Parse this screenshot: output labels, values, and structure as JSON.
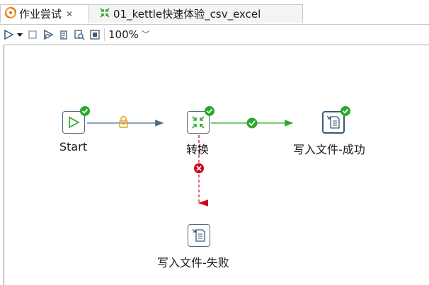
{
  "tabs": [
    {
      "label": "作业尝试",
      "icon": "job-icon",
      "active": true
    },
    {
      "label": "01_kettle快速体验_csv_excel",
      "icon": "transformation-icon",
      "active": false
    }
  ],
  "toolbar": {
    "zoom": "100%",
    "buttons": [
      "run",
      "run-options",
      "stop",
      "preview",
      "debug",
      "check",
      "impact",
      "sql"
    ]
  },
  "canvas": {
    "nodes": [
      {
        "id": "start",
        "label": "Start",
        "icon": "start-icon",
        "status": "success"
      },
      {
        "id": "transform",
        "label": "转换",
        "icon": "transformation-icon",
        "status": "success"
      },
      {
        "id": "write_success",
        "label": "写入文件-成功",
        "icon": "write-file-icon",
        "status": "success"
      },
      {
        "id": "write_fail",
        "label": "写入文件-失败",
        "icon": "write-file-icon",
        "status": "none"
      }
    ],
    "hops": [
      {
        "from": "start",
        "to": "transform",
        "type": "unconditional",
        "icon": "lock-icon"
      },
      {
        "from": "transform",
        "to": "write_success",
        "type": "success",
        "icon": "check-icon"
      },
      {
        "from": "transform",
        "to": "write_fail",
        "type": "failure",
        "icon": "x-icon"
      }
    ]
  },
  "colors": {
    "unconditional_hop": "#4a6c86",
    "success_hop": "#2ca82c",
    "failure_hop": "#d0021b",
    "node_border": "#4a6c86",
    "lock": "#e8a400"
  }
}
